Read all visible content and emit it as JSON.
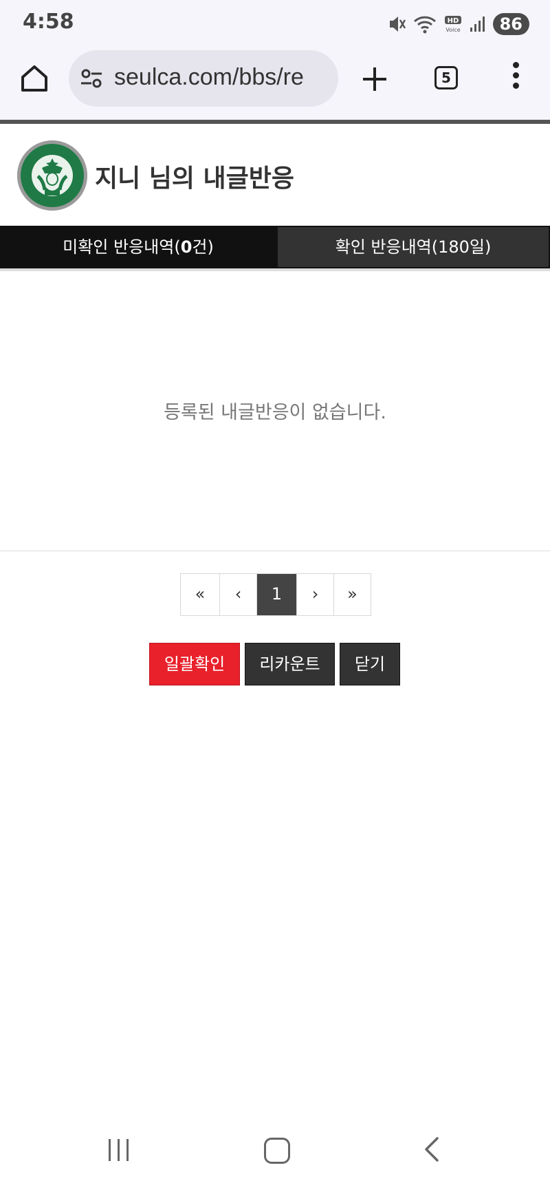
{
  "status_bar": {
    "time": "4:58",
    "battery": "86",
    "icons": [
      "mute-icon",
      "wifi-icon",
      "hd-voice-icon",
      "signal-icon"
    ]
  },
  "browser": {
    "url": "seulca.com/bbs/re",
    "tab_count": "5",
    "icons": [
      "home-icon",
      "site-settings-icon",
      "new-tab-icon",
      "menu-icon"
    ]
  },
  "header": {
    "title": "지니 님의 내글반응"
  },
  "tabs": {
    "unread_prefix": "미확인 반응내역(",
    "unread_count": "0",
    "unread_suffix": "건)",
    "read_label": "확인 반응내역(180일)"
  },
  "empty_message": "등록된 내글반응이 없습니다.",
  "pagination": {
    "first": "«",
    "prev": "‹",
    "current": "1",
    "next": "›",
    "last": "»"
  },
  "actions": {
    "confirm_all": "일괄확인",
    "recount": "리카운트",
    "close": "닫기"
  },
  "colors": {
    "confirm_all_bg": "#e8212b",
    "dark_button_bg": "#333333",
    "unread_tab_bg": "#111111",
    "read_tab_bg": "#333333"
  }
}
